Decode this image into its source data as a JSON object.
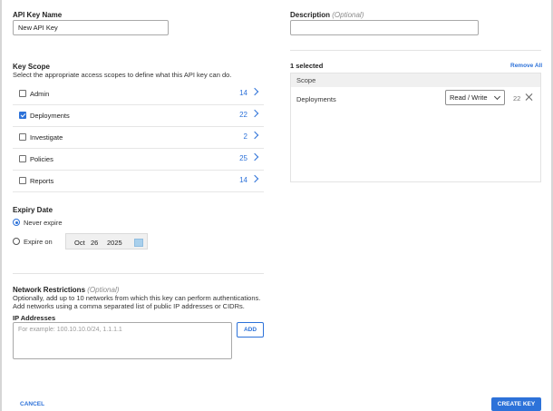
{
  "form": {
    "api_key_name_label": "API Key Name",
    "api_key_name_value": "New API Key",
    "description_label": "Description",
    "description_optional": "(Optional)",
    "description_value": ""
  },
  "key_scope": {
    "title": "Key Scope",
    "subtitle": "Select the appropriate access scopes to define what this API key can do.",
    "items": [
      {
        "name": "Admin",
        "count": "14",
        "checked": false
      },
      {
        "name": "Deployments",
        "count": "22",
        "checked": true
      },
      {
        "name": "Investigate",
        "count": "2",
        "checked": false
      },
      {
        "name": "Policies",
        "count": "25",
        "checked": false
      },
      {
        "name": "Reports",
        "count": "14",
        "checked": false
      }
    ]
  },
  "selection": {
    "selected_text": "1 selected",
    "remove_all": "Remove All",
    "header": "Scope",
    "rows": [
      {
        "name": "Deployments",
        "permission": "Read / Write",
        "count": "22"
      }
    ]
  },
  "expiry": {
    "title": "Expiry Date",
    "never_label": "Never expire",
    "expire_on_label": "Expire on",
    "month": "Oct",
    "day": "26",
    "year": "2025",
    "selected": "never"
  },
  "network": {
    "title": "Network Restrictions",
    "optional": "(Optional)",
    "desc_line1": "Optionally, add up to 10 networks from which this key can perform authentications.",
    "desc_line2": "Add networks using a comma separated list of public IP addresses or CIDRs.",
    "ip_label": "IP Addresses",
    "ip_placeholder": "For example: 100.10.10.0/24, 1.1.1.1",
    "add_label": "ADD"
  },
  "footer": {
    "cancel_label": "CANCEL",
    "create_label": "CREATE KEY"
  },
  "colors": {
    "accent": "#2d72d9",
    "divider": "#e3e3e3",
    "calendar_swatch": "#a9d0ec"
  },
  "icons": {
    "row_chevron": "chevron-right-icon",
    "checkbox": "checkbox-icon",
    "remove": "close-icon",
    "dropdown": "chevron-down-icon",
    "calendar": "calendar-icon"
  }
}
